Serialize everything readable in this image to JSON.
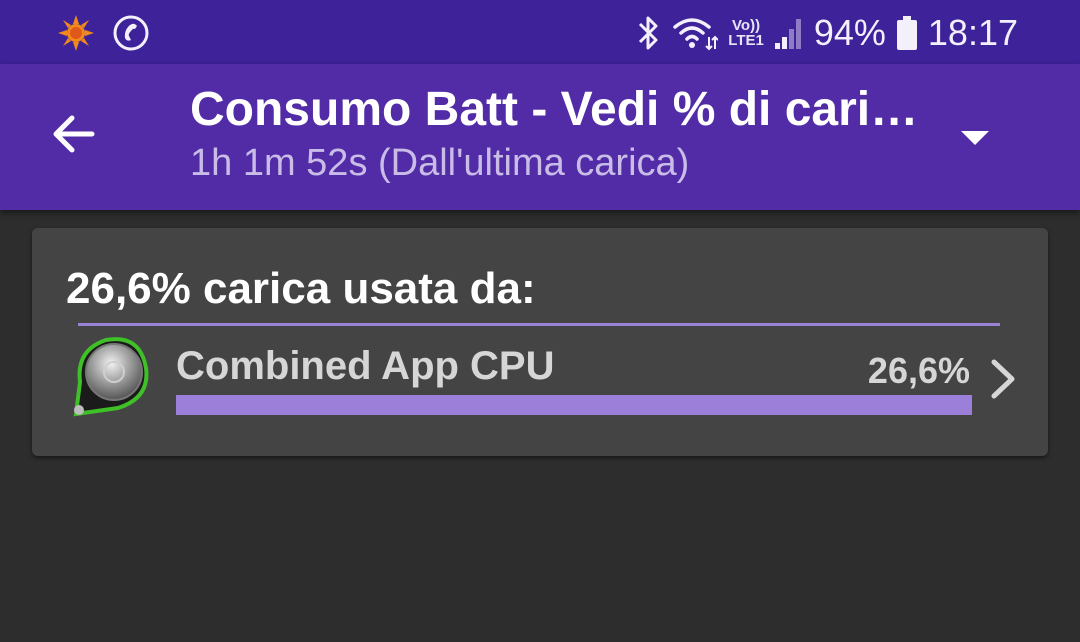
{
  "status_bar": {
    "battery_percent": "94%",
    "time": "18:17",
    "network_top": "Vo))",
    "network_bottom": "LTE1",
    "icons": [
      "sun-icon",
      "phone-icon",
      "bluetooth-icon",
      "wifi-icon",
      "signal-icon",
      "battery-icon"
    ]
  },
  "app_bar": {
    "title": "Consumo Batt - Vedi % di cari…",
    "subtitle": "1h 1m 52s (Dall'ultima carica)"
  },
  "usage_card": {
    "heading": "26,6% carica usata da:",
    "items": [
      {
        "name": "Combined App CPU",
        "percent_label": "26,6%",
        "bar_fill": 1.0
      }
    ]
  },
  "colors": {
    "status_bar": "#3d2299",
    "app_bar": "#522ba6",
    "background": "#2d2d2d",
    "card": "#444444",
    "accent_bar": "#9b7fd8"
  }
}
